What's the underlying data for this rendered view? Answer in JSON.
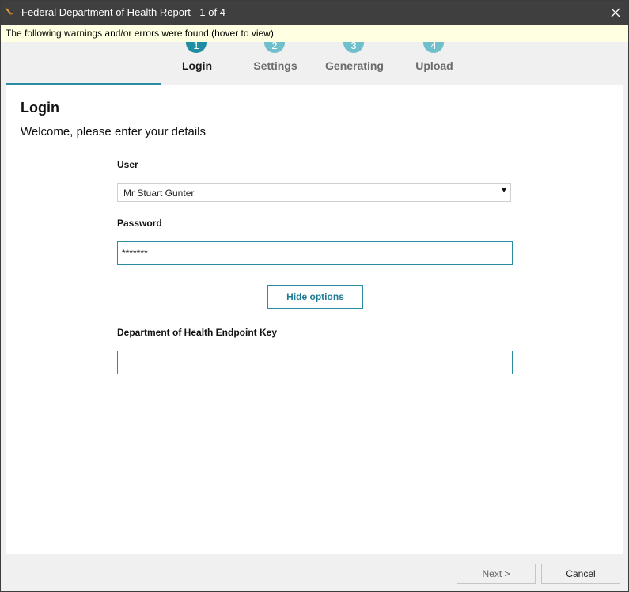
{
  "window": {
    "title": "Federal Department of Health Report - 1 of 4"
  },
  "warning": {
    "text": "The following warnings and/or errors were found (hover to view):"
  },
  "steps": [
    {
      "number": "1",
      "label": "Login",
      "active": true
    },
    {
      "number": "2",
      "label": "Settings",
      "active": false
    },
    {
      "number": "3",
      "label": "Generating",
      "active": false
    },
    {
      "number": "4",
      "label": "Upload",
      "active": false
    }
  ],
  "page": {
    "title": "Login",
    "subtitle": "Welcome, please enter your details"
  },
  "form": {
    "user_label": "User",
    "user_value": "Mr Stuart Gunter",
    "password_label": "Password",
    "password_value": "*******",
    "options_button": "Hide options",
    "endpoint_label": "Department of Health Endpoint Key",
    "endpoint_value": ""
  },
  "footer": {
    "next": "Next >",
    "cancel": "Cancel"
  },
  "colors": {
    "accent": "#2a8ba3",
    "step_active": "#1f8ea3",
    "step_inactive": "#6fbfcc",
    "titlebar": "#3f3f3f",
    "warning_bg": "#ffffe1"
  }
}
